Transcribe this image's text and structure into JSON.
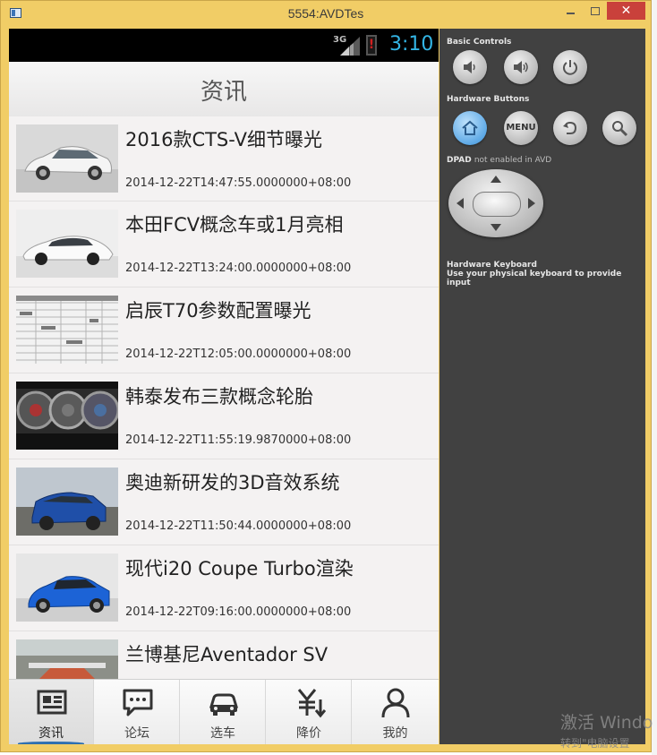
{
  "window": {
    "title": "5554:AVDTes",
    "minimize_label": "",
    "close_label": "✕"
  },
  "status_bar": {
    "network": "3G",
    "time": "3:10"
  },
  "header": {
    "title": "资讯"
  },
  "news": [
    {
      "title": "2016款CTS-V细节曝光",
      "time": "2014-12-22T14:47:55.0000000+08:00",
      "thumb": "white-sedan"
    },
    {
      "title": "本田FCV概念车或1月亮相",
      "time": "2014-12-22T13:24:00.0000000+08:00",
      "thumb": "white-concept-car"
    },
    {
      "title": "启辰T70参数配置曝光",
      "time": "2014-12-22T12:05:00.0000000+08:00",
      "thumb": "spec-table"
    },
    {
      "title": "韩泰发布三款概念轮胎",
      "time": "2014-12-22T11:55:19.9870000+08:00",
      "thumb": "concept-tires"
    },
    {
      "title": "奥迪新研发的3D音效系统",
      "time": "2014-12-22T11:50:44.0000000+08:00",
      "thumb": "blue-suv"
    },
    {
      "title": "现代i20 Coupe Turbo渲染",
      "time": "2014-12-22T09:16:00.0000000+08:00",
      "thumb": "blue-hatchback"
    },
    {
      "title": "兰博基尼Aventador SV",
      "time": "",
      "thumb": "road-car"
    }
  ],
  "tabs": [
    {
      "label": "资讯",
      "icon": "news-icon",
      "active": true
    },
    {
      "label": "论坛",
      "icon": "forum-icon",
      "active": false
    },
    {
      "label": "选车",
      "icon": "car-icon",
      "active": false
    },
    {
      "label": "降价",
      "icon": "price-down-icon",
      "active": false
    },
    {
      "label": "我的",
      "icon": "user-icon",
      "active": false
    }
  ],
  "controls": {
    "basic_controls_label": "Basic Controls",
    "hardware_buttons_label": "Hardware Buttons",
    "menu_label": "MENU",
    "dpad_label": "DPAD",
    "dpad_note": "not enabled in AVD",
    "keyboard_label": "Hardware Keyboard",
    "keyboard_note": "Use your physical keyboard to provide input"
  },
  "watermark": {
    "line1": "激活 Windo",
    "line2": "转到\"电脑设置"
  },
  "colors": {
    "window_frame": "#f1cd66",
    "clock": "#33b5e5",
    "close_button": "#c9413b",
    "active_tab_accent": "#2e6fb0",
    "panel_bg": "#414141"
  }
}
